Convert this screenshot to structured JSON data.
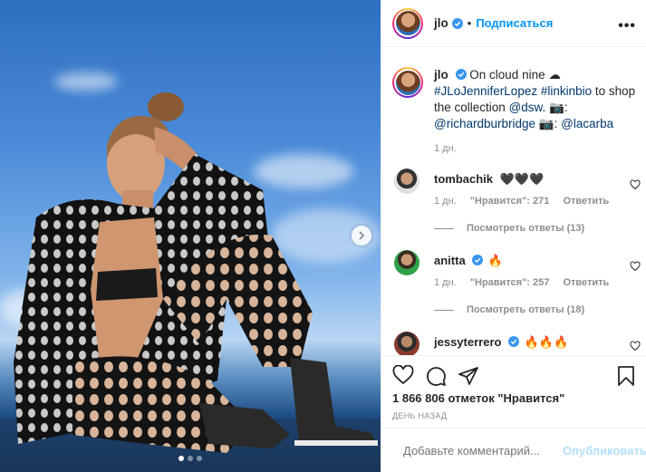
{
  "post": {
    "username": "jlo",
    "subscribe_label": "Подписаться",
    "more_icon": "more-dots-icon",
    "caption": {
      "username": "jlo",
      "text_1": "On cloud nine ☁",
      "hashtags": "#JLoJenniferLopez #linkinbio",
      "text_2": " to shop the collection ",
      "mention_1": "@dsw.",
      "camera_1": "📷:",
      "mention_2": "@richardburbridge",
      "camera_2": "📷:",
      "mention_3": "@lacarba",
      "time": "1 дн."
    },
    "comments": [
      {
        "username": "tombachik",
        "emoji": "🖤🖤🖤",
        "time": "1 дн.",
        "likes": "\"Нравится\": 271",
        "reply_label": "Ответить",
        "view_replies": "Посмотреть ответы (13)"
      },
      {
        "username": "anitta",
        "emoji": "🔥",
        "time": "1 дн.",
        "likes": "\"Нравится\": 257",
        "reply_label": "Ответить",
        "view_replies": "Посмотреть ответы (18)"
      },
      {
        "username": "jessyterrero",
        "emoji": "🔥🔥🔥"
      }
    ],
    "likes_count": "1 866 806 отметок \"Нравится\"",
    "date": "ДЕНЬ НАЗАД",
    "add_comment_placeholder": "Добавьте комментарий...",
    "publish_label": "Опубликовать",
    "carousel": {
      "current": 1,
      "total": 3
    },
    "colors": {
      "accent": "#0095f6",
      "publish_disabled": "#b2dffc",
      "verified": "#3897f0"
    }
  }
}
